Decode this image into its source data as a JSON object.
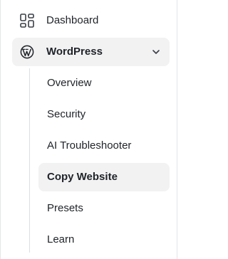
{
  "nav": {
    "dashboard": {
      "label": "Dashboard",
      "icon": "dashboard-grid-icon"
    },
    "wordpress": {
      "label": "WordPress",
      "icon": "wordpress-logo-icon",
      "expanded": true,
      "chevron": "chevron-down-icon",
      "items": [
        {
          "label": "Overview"
        },
        {
          "label": "Security"
        },
        {
          "label": "AI Troubleshooter"
        },
        {
          "label": "Copy Website",
          "active": true
        },
        {
          "label": "Presets"
        },
        {
          "label": "Learn"
        }
      ]
    }
  },
  "colors": {
    "text": "#1f2328",
    "active_bg": "#f2f2f3",
    "border": "#e3e5e8",
    "tree_line": "#dcdfe3"
  }
}
